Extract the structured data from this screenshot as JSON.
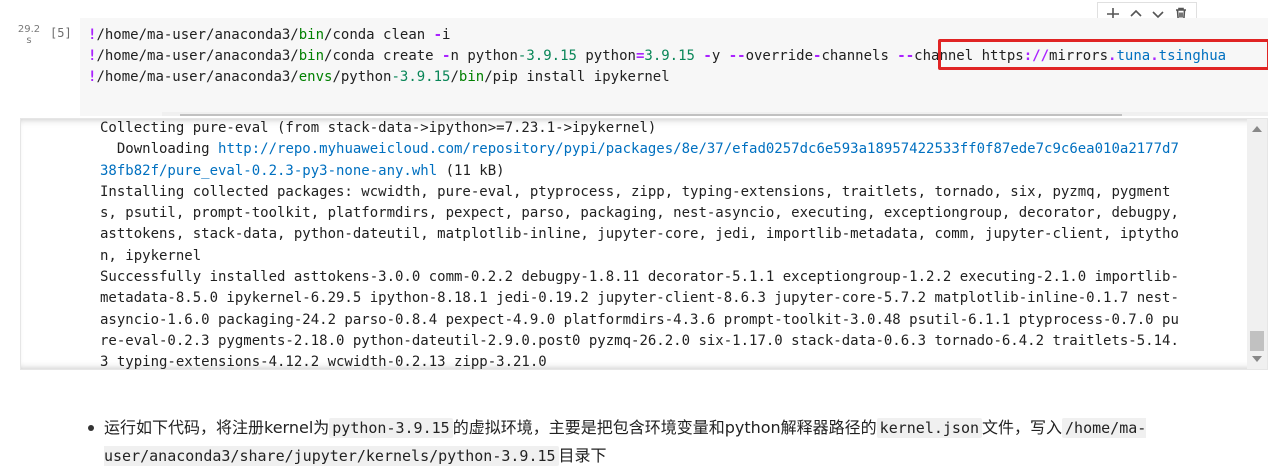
{
  "prompt": {
    "exec_time": "29.2 s",
    "exec_count": "[5]"
  },
  "code_lines": [
    [
      {
        "t": "!",
        "c": "kw-op"
      },
      {
        "t": "/home/ma-user/anaconda3/"
      },
      {
        "t": "bin",
        "c": "kw-dir"
      },
      {
        "t": "/conda clean "
      },
      {
        "t": "-",
        "c": "kw-op"
      },
      {
        "t": "i"
      }
    ],
    [
      {
        "t": "!",
        "c": "kw-op"
      },
      {
        "t": "/home/ma-user/anaconda3/"
      },
      {
        "t": "bin",
        "c": "kw-dir"
      },
      {
        "t": "/conda create "
      },
      {
        "t": "-",
        "c": "kw-op"
      },
      {
        "t": "n python"
      },
      {
        "t": "-3.9.15",
        "c": "kw-num"
      },
      {
        "t": " python"
      },
      {
        "t": "=",
        "c": "kw-op"
      },
      {
        "t": "3.9.15",
        "c": "kw-num"
      },
      {
        "t": " "
      },
      {
        "t": "-",
        "c": "kw-op"
      },
      {
        "t": "y "
      },
      {
        "t": "--",
        "c": "kw-op"
      },
      {
        "t": "override"
      },
      {
        "t": "-",
        "c": "kw-op"
      },
      {
        "t": "channels "
      },
      {
        "t": "--",
        "c": "kw-op"
      },
      {
        "t": "channel https"
      },
      {
        "t": "://",
        "c": "kw-op"
      },
      {
        "t": "mirrors"
      },
      {
        "t": ".",
        "c": "kw-op"
      },
      {
        "t": "tuna",
        "c": "kw-url"
      },
      {
        "t": ".",
        "c": "kw-op"
      },
      {
        "t": "tsinghua",
        "c": "kw-url"
      }
    ],
    [
      {
        "t": "!",
        "c": "kw-op"
      },
      {
        "t": "/home/ma-user/anaconda3/"
      },
      {
        "t": "envs",
        "c": "kw-dir"
      },
      {
        "t": "/python"
      },
      {
        "t": "-3.9.15",
        "c": "kw-num"
      },
      {
        "t": "/"
      },
      {
        "t": "bin",
        "c": "kw-dir"
      },
      {
        "t": "/pip install ipykernel"
      }
    ]
  ],
  "output": {
    "line1": "Collecting pure-eval (from stack-data->ipython>=7.23.1->ipykernel)",
    "line2_prefix": "  Downloading ",
    "download_url_part1": "http://repo.myhuaweicloud.com/repository/pypi/packages/8e/37/efad0257dc6e593a18957422533ff0f87ede7c9c6ea010a2177d7",
    "download_url_part2": "38fb82f/pure_eval-0.2.3-py3-none-any.whl",
    "line3_suffix": " (11 kB)",
    "installing": [
      "Installing collected packages: wcwidth, pure-eval, ptyprocess, zipp, typing-extensions, traitlets, tornado, six, pyzmq, pygment",
      "s, psutil, prompt-toolkit, platformdirs, pexpect, parso, packaging, nest-asyncio, executing, exceptiongroup, decorator, debugpy,",
      "asttokens, stack-data, python-dateutil, matplotlib-inline, jupyter-core, jedi, importlib-metadata, comm, jupyter-client, iptytho",
      "n, ipykernel"
    ],
    "success": [
      "Successfully installed asttokens-3.0.0 comm-0.2.2 debugpy-1.8.11 decorator-5.1.1 exceptiongroup-1.2.2 executing-2.1.0 importlib-",
      "metadata-8.5.0 ipykernel-6.29.5 ipython-8.18.1 jedi-0.19.2 jupyter-client-8.6.3 jupyter-core-5.7.2 matplotlib-inline-0.1.7 nest-",
      "asyncio-1.6.0 packaging-24.2 parso-0.8.4 pexpect-4.9.0 platformdirs-4.3.6 prompt-toolkit-3.0.48 psutil-6.1.1 ptyprocess-0.7.0 pu",
      "re-eval-0.2.3 pygments-2.18.0 python-dateutil-2.9.0.post0 pyzmq-26.2.0 six-1.17.0 stack-data-0.6.3 tornado-6.4.2 traitlets-5.14.",
      "3 typing-extensions-4.12.2 wcwidth-0.2.13 zipp-3.21.0"
    ]
  },
  "markdown": {
    "text1": "运行如下代码，将注册kernel为",
    "code1": "python-3.9.15",
    "text2": "的虚拟环境，主要是把包含环境变量和python解释器路径的",
    "code2": "kernel.json",
    "text3": "文件，写入",
    "code3": "/home/ma-user/anaconda3/share/jupyter/kernels/python-3.9.15",
    "text4": "目录下"
  },
  "toolbar_icons": [
    "plus-icon",
    "chevron-up-icon",
    "chevron-down-icon",
    "trash-icon"
  ],
  "colors": {
    "highlight": "#e02424",
    "link": "#0070c0"
  }
}
